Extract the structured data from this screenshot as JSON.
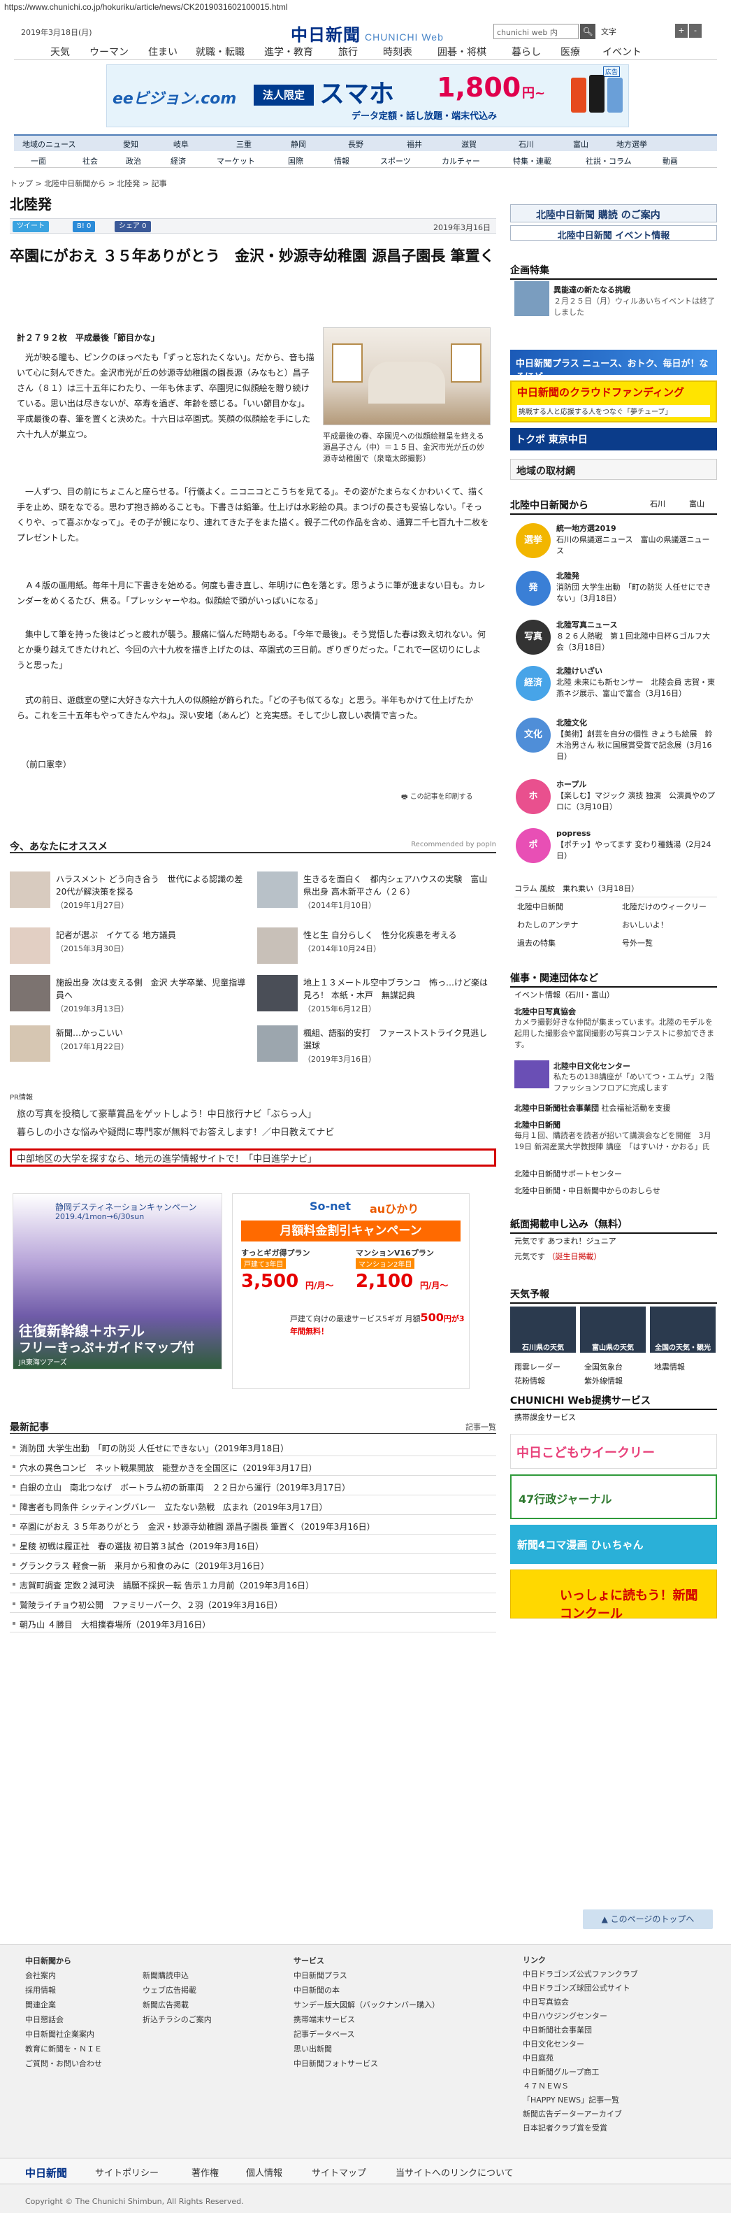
{
  "url": "https://www.chunichi.co.jp/hokuriku/article/news/CK2019031602100015.html",
  "header": {
    "date": "2019年3月18日(月)",
    "logo": "中日新聞",
    "logo_sub": "CHUNICHI Web",
    "search_placeholder": "chunichi web 内",
    "font_label": "文字",
    "font_plus": "+",
    "font_minus": "-"
  },
  "gnav": [
    "天気",
    "ウーマン",
    "住まい",
    "就職・転職",
    "進学・教育",
    "旅行",
    "時刻表",
    "囲碁・将棋",
    "暮らし",
    "医療",
    "イベント"
  ],
  "ad_top": {
    "brand": "eeビジョン.com",
    "label": "法人限定",
    "headline": "スマホ",
    "price": "1,800",
    "unit": "円~",
    "tag": "広告",
    "sub": "データ定額・話し放題・端末代込み"
  },
  "nav2": [
    "地域のニュース",
    "愛知",
    "岐阜",
    "三重",
    "静岡",
    "長野",
    "福井",
    "滋賀",
    "石川",
    "富山",
    "地方選挙"
  ],
  "nav3": [
    "一面",
    "社会",
    "政治",
    "経済",
    "マーケット",
    "国際",
    "情報",
    "スポーツ",
    "カルチャー",
    "特集・連載",
    "社説・コラム",
    "動画"
  ],
  "breadcrumb": "トップ > 北陸中日新聞から > 北陸発 > 記事",
  "page_title": "北陸発",
  "share": {
    "tweet": "ツイート",
    "hatena": "B! 0",
    "fb": "シェア 0"
  },
  "article": {
    "date": "2019年3月16日",
    "title": "卒園にがおえ ３５年ありがとう　金沢・妙源寺幼稚園 源昌子園長 筆置く",
    "lead": "計２７９２枚　平成最後「節目かな」",
    "caption": "平成最後の春、卒園児への似顔絵贈呈を終える源昌子さん（中）＝１５日、金沢市光が丘の妙源寺幼稚園で（泉竜太郎撮影）",
    "paragraphs": [
      "　光が映る瞳も、ピンクのほっぺたも「ずっと忘れたくない」。だから、音も描いて心に刻んできた。金沢市光が丘の妙源寺幼稚園の園長源（みなもと）昌子さん（８１）は三十五年にわたり、一年も休まず、卒園児に似顔絵を贈り続けている。思い出は尽きないが、卒寿を過ぎ、年齢を感じる。「いい節目かな」。平成最後の春、筆を置くと決めた。十六日は卒園式。笑顔の似顔絵を手にした六十九人が巣立つ。",
      "　一人ずつ、目の前にちょこんと座らせる。「行儀よく。ニコニコとこうちを見てる」。その姿がたまらなくかわいくて、描く手を止め、頭をなでる。思わず抱き締めることも。下書きは鉛筆。仕上げは水彩絵の具。まつげの長さも妥協しない。「そっくりや、って喜ぶかなって」。その子が親になり、連れてきた子をまた描く。親子二代の作品を含め、通算二千七百九十二枚をプレゼントした。",
      "　Ａ４版の画用紙。毎年十月に下書きを始める。何度も書き直し、年明けに色を落とす。思うように筆が進まない日も。カレンダーをめくるたび、焦る。「プレッシャーやね。似顔絵で頭がいっぱいになる」",
      "　集中して筆を持った後はどっと疲れが襲う。腰痛に悩んだ時期もある。「今年で最後」。そう覚悟した春は数え切れない。何とか乗り越えてきたけれど、今回の六十九枚を描き上げたのは、卒園式の三日前。ぎりぎりだった。「これで一区切りにしようと思った」",
      "　式の前日、遊戯室の壁に大好きな六十九人の似顔絵が飾られた。「どの子も似てるな」と思う。半年もかけて仕上げたから。これを三十五年もやってきたんやね」。深い安堵（あんど）と充実感。そして少し寂しい表情で言った。",
      "　（前口憲幸）"
    ],
    "print": "この記事を印刷する"
  },
  "osusume": {
    "title": "今、あなたにオススメ",
    "recommended": "Recommended by popIn",
    "items": [
      {
        "title": "ハラスメント どう向き合う　世代による認識の差 20代が解決策を探る",
        "date": "（2019年1月27日）"
      },
      {
        "title": "生きるを面白く　都内シェアハウスの実験　富山県出身 高木新平さん（２６）",
        "date": "（2014年1月10日）"
      },
      {
        "title": "記者が選ぶ　イケてる 地方議員",
        "date": "（2015年3月30日）"
      },
      {
        "title": "性と生 自分らしく　性分化疾患を考える",
        "date": "（2014年10月24日）"
      },
      {
        "title": "施設出身 次は支える側　金沢 大学卒業、児童指導員へ",
        "date": "（2019年3月13日）"
      },
      {
        "title": "地上１３メートル空中ブランコ　怖っ…けど楽は見ろ！ 本紙・木戸　無謀記典",
        "date": "（2015年6月12日）"
      },
      {
        "title": "新聞…かっこいい",
        "date": "（2017年1月22日）"
      },
      {
        "title": "楓組、語脳的安打　ファーストストライク見逃し選球",
        "date": "（2019年3月16日）"
      }
    ]
  },
  "pr": {
    "label": "PR情報",
    "items": [
      "旅の写真を投稿して豪華賞品をゲットしよう！中日旅行ナビ「ぶらっ人」",
      "暮らしの小さな悩みや疑問に専門家が無料でお答えします！／中日教えてナビ",
      "中部地区の大学を探すなら、地元の進学情報サイトで！「中日進学ナビ」"
    ]
  },
  "ads_mid": {
    "a1_title": "静岡デスティネーションキャンペーン",
    "a1_date": "2019.4/1mon→6/30sun",
    "a1_main": "往復新幹線＋ホテル",
    "a1_sub": "フリーきっぷ＋ガイドマップ付",
    "a1_brand": "JR東海ツアーズ",
    "a2_brand1": "So-net",
    "a2_brand2": "auひかり",
    "a2_head": "月額料金割引キャンペーン",
    "a2_p1": "すっとギガ得プラン",
    "a2_p1b": "戸建て3年目",
    "a2_p1v": "3,500",
    "a2_p2": "マンションV16プラン",
    "a2_p2b": "マンション2年目",
    "a2_p2v": "2,100",
    "a2_yen": "円/月～",
    "a2_foot": "500",
    "a2_foot_pre": "戸建て向けの最速サービス5ギガ 月額",
    "a2_foot_suf": "円が3年間無料！"
  },
  "latest": {
    "title": "最新記事",
    "link": "記事一覧",
    "items": [
      "消防団 大学生出動　「町の防災 人任せにできない」（2019年3月18日）",
      "穴水の異色コンビ　ネット戦果開放　能登かきを全国区に（2019年3月17日）",
      "白銀の立山　南北つなげ　ボートラム初の新車両　２２日から運行（2019年3月17日）",
      "障害者も同条件 シッティングバレー　立たない熱戦　広まれ（2019年3月17日）",
      "卒園にがおえ ３５年ありがとう　金沢・妙源寺幼稚園 源昌子園長 筆置く（2019年3月16日）",
      "星稜 初戦は履正社　春の選抜 初日第３試合（2019年3月16日）",
      "グランクラス 軽食一新　来月から和食のみに（2019年3月16日）",
      "志賀町調査 定数２減可決　請願不採択一転 告示１カ月前（2019年3月16日）",
      "鷲陵ライチョウ初公開　ファミリーパーク、２羽（2019年3月16日）",
      "朝乃山 ４勝目　大相撲春場所（2019年3月16日）"
    ]
  },
  "side": {
    "bn1": "北陸中日新聞 購読 のご案内",
    "bn2": "北陸中日新聞 イベント情報",
    "kikaku": "企画特集",
    "kikaku_t": "異能達の新たなる挑戦",
    "kikaku_d": "２月２５日（月）ウィルあいちイベントは終了しました",
    "plus": "中日新聞プラス ニュース、おトク、毎日が！なるほど",
    "cf": "中日新聞のクラウドファンディング",
    "cf_sub": "挑戦する人と応援する人をつなぐ「夢チューブ」",
    "toku": "トクポ 東京中日",
    "chiiki": "地域の取材網",
    "kara": "北陸中日新聞から",
    "kara_l1": "石川",
    "kara_l2": "富山",
    "news": [
      {
        "ico": "選挙",
        "t": "統一地方選2019",
        "d": "石川の県議選ニュース　富山の県議選ニュース"
      },
      {
        "ico": "発",
        "t": "北陸発",
        "d": "消防団 大学生出動　「町の防災 人任せにできない」（3月18日）"
      },
      {
        "ico": "写真",
        "t": "北陸写真ニュース",
        "d": "８２６人熱戦　第１回北陸中日杯Ｇゴルフ大会（3月18日）"
      },
      {
        "ico": "経済",
        "t": "北陸けいざい",
        "d": "北陸 未来にも新センサー　北陸会員 志賀・東燕ネジ展示、富山で富合（3月16日）"
      },
      {
        "ico": "文化",
        "t": "北陸文化",
        "d": "【美術】創芸を自分の個性 きょうも絵展　鈴木治男さん 秋に国展賞受賞で記念展（3月16日）"
      },
      {
        "ico": "ホ",
        "t": "ホープル",
        "d": "【楽しむ】マジック 演技 独演　公演員やのプロに（3月10日）"
      },
      {
        "ico": "ポ",
        "t": "popress",
        "d": "【ポチッ】やってます 変わり種銭湯（2月24日）"
      }
    ],
    "links": [
      "コラム 風紋　乗れ乗い（3月18日）",
      "北陸中日新聞",
      "北陸だけのウィークリー",
      "わたしのアンテナ",
      "おいしいよ！",
      "過去の特集",
      "号外一覧"
    ],
    "moyo": "催事・関連団体など",
    "moyo_ev": "イベント情報（石川・富山）",
    "moyo_items": [
      {
        "t": "北陸中日写真協会",
        "d": "カメラ撮影好きな仲間が集まっています。北陸のモデルを起用した撮影会や富岡撮影の写真コンテストに参加できます。"
      },
      {
        "t": "北陸中日文化センター",
        "d": "私たちの138講座が「めいてつ・エムザ」２階ファッションフロアに完成します"
      },
      {
        "t": "北陸中日新聞社会事業団",
        "d": "社会福祉活動を支援"
      },
      {
        "t": "北陸中日新聞",
        "d": "毎月１回、購読者を読者が招いて講演会などを開催　3月19日 新潟産業大学教授陣 講座　「はすいけ・かおる」氏"
      },
      {
        "t": "北陸中日新聞サポートセンター",
        "d": ""
      },
      {
        "t": "北陸中日新聞・中日新聞中からのおしらせ",
        "d": ""
      }
    ],
    "shimen": "紙面掲載申し込み（無料）",
    "shimen1": "元気です あつまれ！ジュニア",
    "shimen2": "元気です",
    "shimen2b": "（誕生日掲載）",
    "tenki": "天気予報",
    "tenki1": "石川県の天気",
    "tenki2": "富山県の天気",
    "tenki3": "全国の天気・観光",
    "tenki_links": [
      "雨雲レーダー",
      "全国気象台",
      "地震情報",
      "花粉情報",
      "紫外線情報"
    ],
    "cweb": "CHUNICHI Web提携サービス",
    "cweb_l": "携帯課金サービス",
    "kodomo": "中日こどもウイークリー",
    "gyosei": "47行政ジャーナル",
    "hityan": "新聞4コマ漫画 ひぃちゃん",
    "nie": "いっしょに読もう！新聞コンクール"
  },
  "pagetop": "このページのトップへ",
  "footer": {
    "c1h": "中日新聞から",
    "c1": [
      "会社案内",
      "採用情報",
      "関連企業",
      "中日懇話会",
      "中日新聞社企業案内",
      "教育に新聞を・ＮＩＥ",
      "ご質問・お問い合わせ"
    ],
    "c2": [
      "新聞購読申込",
      "ウェブ広告掲載",
      "新聞広告掲載",
      "折込チラシのご案内"
    ],
    "c3h": "サービス",
    "c3": [
      "中日新聞プラス",
      "中日新聞の本",
      "サンデー版大図解（バックナンバー購入）",
      "携帯端末サービス",
      "記事データベース",
      "思い出新聞",
      "中日新聞フォトサービス"
    ],
    "c4h": "リンク",
    "c4": [
      "中日ドラゴンズ公式ファンクラブ",
      "中日ドラゴンズ球団公式サイト",
      "中日写真協会",
      "中日ハウジングセンター",
      "中日新聞社会事業団",
      "中日文化センター",
      "中日庭苑",
      "中日新聞グループ商工",
      "４７ＮＥＷＳ",
      "「HAPPY NEWS」記事一覧",
      "新聞広告データーアーカイブ",
      "日本記者クラブ賞を受賞"
    ],
    "bar": [
      "中日新聞",
      "サイトポリシー",
      "著作権",
      "個人情報",
      "サイトマップ",
      "当サイトへのリンクについて"
    ],
    "copy": "Copyright © The Chunichi Shimbun, All Rights Reserved."
  }
}
